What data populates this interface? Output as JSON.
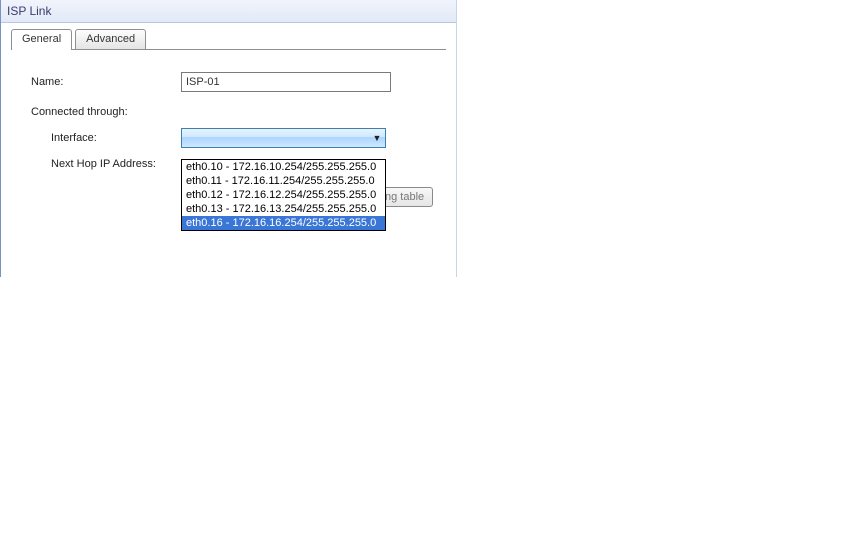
{
  "window": {
    "title": "ISP Link"
  },
  "tabs": {
    "general": "General",
    "advanced": "Advanced"
  },
  "form": {
    "name_label": "Name:",
    "name_value": "ISP-01",
    "connected_label": "Connected through:",
    "interface_label": "Interface:",
    "nexthop_label": "Next Hop IP Address:",
    "routing_button_fragment": "ng table"
  },
  "interface_options": [
    "eth0.10 - 172.16.10.254/255.255.255.0",
    "eth0.11 - 172.16.11.254/255.255.255.0",
    "eth0.12 - 172.16.12.254/255.255.255.0",
    "eth0.13 - 172.16.13.254/255.255.255.0",
    "eth0.16 - 172.16.16.254/255.255.255.0"
  ],
  "interface_selected_index": 4
}
